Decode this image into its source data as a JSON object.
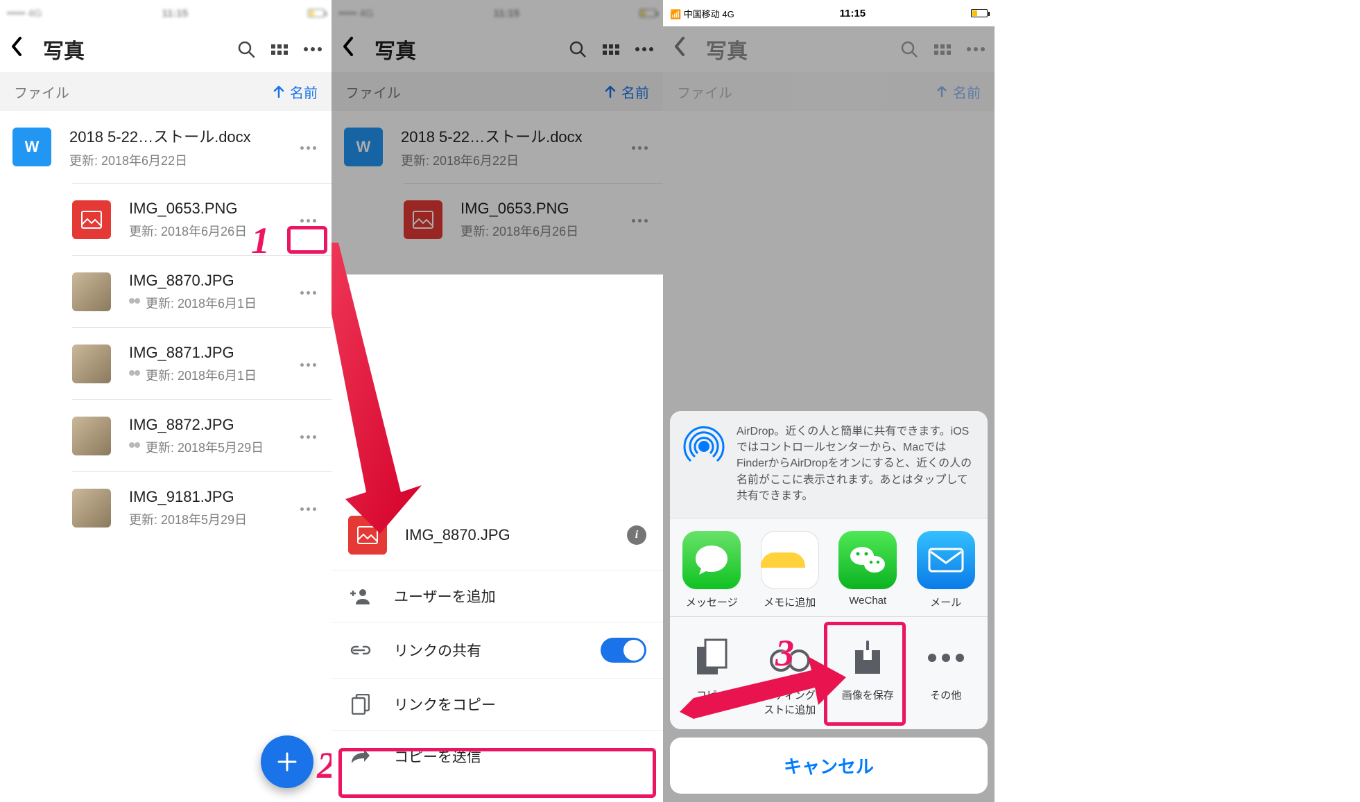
{
  "header": {
    "title": "写真"
  },
  "sortbar": {
    "section": "ファイル",
    "sort_label": "名前"
  },
  "files": [
    {
      "name": "2018 5-22…ストール.docx",
      "updated": "更新: 2018年6月22日",
      "kind": "word",
      "shared": false
    },
    {
      "name": "IMG_0653.PNG",
      "updated": "更新: 2018年6月26日",
      "kind": "img",
      "shared": false
    },
    {
      "name": "IMG_8870.JPG",
      "updated": "更新: 2018年6月1日",
      "kind": "photo",
      "shared": true
    },
    {
      "name": "IMG_8871.JPG",
      "updated": "更新: 2018年6月1日",
      "kind": "photo",
      "shared": true
    },
    {
      "name": "IMG_8872.JPG",
      "updated": "更新: 2018年5月29日",
      "kind": "photo",
      "shared": true
    },
    {
      "name": "IMG_9181.JPG",
      "updated": "更新: 2018年5月29日",
      "kind": "photo",
      "shared": false
    }
  ],
  "sheet": {
    "file_name": "IMG_8870.JPG",
    "options": {
      "add_user": "ユーザーを追加",
      "link_share": "リンクの共有",
      "copy_link": "リンクをコピー",
      "send_copy": "コピーを送信"
    },
    "link_share_on": true
  },
  "ios_share": {
    "airdrop_text": "AirDrop。近くの人と簡単に共有できます。iOSではコントロールセンターから、MacではFinderからAirDropをオンにすると、近くの人の名前がここに表示されます。あとはタップして共有できます。",
    "apps": [
      "メッセージ",
      "メモに追加",
      "WeChat",
      "メール"
    ],
    "actions": [
      "コピー",
      "リーディングリストに追加",
      "画像を保存",
      "その他"
    ],
    "cancel": "キャンセル"
  },
  "steps": {
    "one": "1",
    "two": "2",
    "three": "3"
  }
}
